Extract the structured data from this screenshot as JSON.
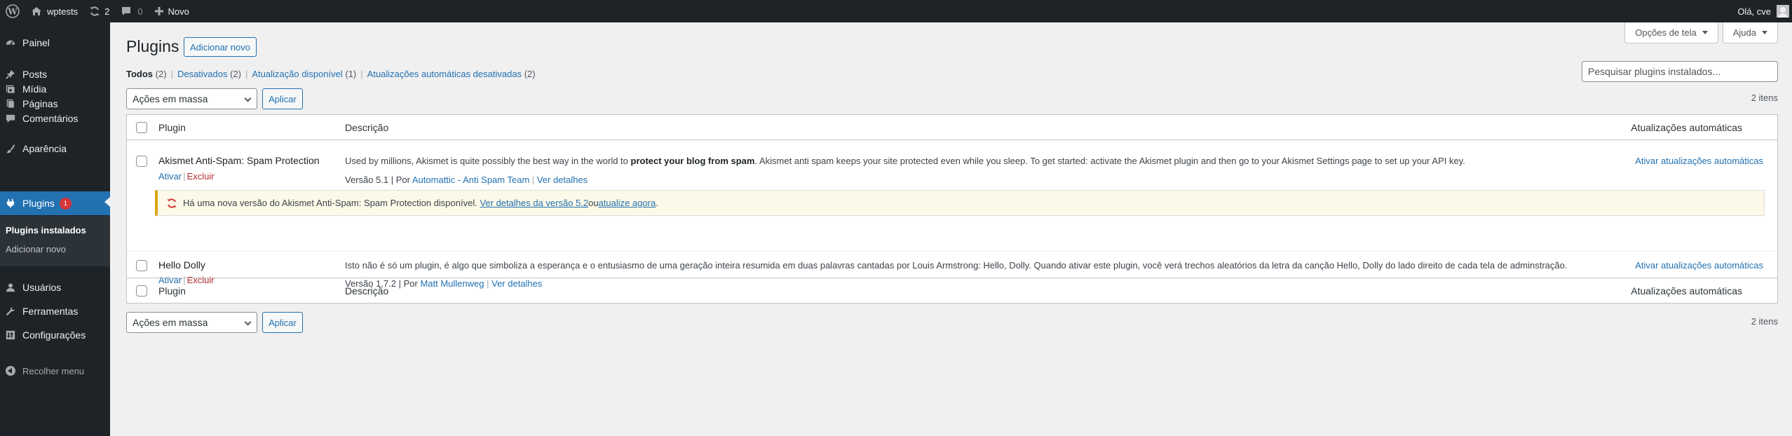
{
  "adminbar": {
    "site_name": "wptests",
    "updates_count": "2",
    "comments_count": "0",
    "new_label": "Novo",
    "greeting": "Olá, cve"
  },
  "sidebar": {
    "items": [
      {
        "label": "Painel",
        "icon": "dashboard-icon"
      },
      {
        "label": "Posts",
        "icon": "pin-icon"
      },
      {
        "label": "Mídia",
        "icon": "media-icon"
      },
      {
        "label": "Páginas",
        "icon": "page-icon"
      },
      {
        "label": "Comentários",
        "icon": "comment-icon"
      },
      {
        "label": "Aparência",
        "icon": "brush-icon"
      },
      {
        "label": "Plugins",
        "icon": "plugin-icon",
        "badge": "1"
      },
      {
        "label": "Usuários",
        "icon": "users-icon"
      },
      {
        "label": "Ferramentas",
        "icon": "wrench-icon"
      },
      {
        "label": "Configurações",
        "icon": "settings-icon"
      }
    ],
    "submenu": [
      "Plugins instalados",
      "Adicionar novo"
    ],
    "collapse_label": "Recolher menu"
  },
  "screen_options": {
    "label": "Opções de tela",
    "help": "Ajuda"
  },
  "page": {
    "title": "Plugins",
    "add_new": "Adicionar novo"
  },
  "views": {
    "all": "Todos",
    "all_count": "(2)",
    "inactive": "Desativados",
    "inactive_count": "(2)",
    "update": "Atualização disponível",
    "update_count": "(1)",
    "autoupdate_off": "Atualizações automáticas desativadas",
    "autoupdate_off_count": "(2)"
  },
  "search": {
    "placeholder": "Pesquisar plugins instalados..."
  },
  "bulk": {
    "label": "Ações em massa",
    "apply": "Aplicar",
    "items_count": "2 itens"
  },
  "table": {
    "columns": {
      "plugin": "Plugin",
      "description": "Descrição",
      "auto_updates": "Atualizações automáticas"
    },
    "rows": [
      {
        "name": "Akismet Anti-Spam: Spam Protection",
        "activate": "Ativar",
        "delete": "Excluir",
        "desc_pre": "Used by millions, Akismet is quite possibly the best way in the world to ",
        "desc_bold": "protect your blog from spam",
        "desc_post": ". Akismet anti spam keeps your site protected even while you sleep. To get started: activate the Akismet plugin and then go to your Akismet Settings page to set up your API key.",
        "version": "Versão 5.1 | Por ",
        "author": "Automattic - Anti Spam Team",
        "details": "Ver detalhes",
        "auto_update": "Ativar atualizações automáticas"
      },
      {
        "name": "Hello Dolly",
        "activate": "Ativar",
        "delete": "Excluir",
        "desc": "Isto não é só um plugin, é algo que simboliza a esperança e o entusiasmo de uma geração inteira resumida em duas palavras cantadas por Louis Armstrong: Hello, Dolly. Quando ativar este plugin, você verá trechos aleatórios da letra da canção Hello, Dolly do lado direito de cada tela de adminstração.",
        "version": "Versão 1.7.2 | Por ",
        "author": "Matt Mullenweg",
        "details": "Ver detalhes",
        "auto_update": "Ativar atualizações automáticas"
      }
    ],
    "notice": {
      "text": "Há uma nova versão do Akismet Anti-Spam: Spam Protection disponível. ",
      "details_link": "Ver detalhes da versão 5.2",
      "or": " ou ",
      "update_link": "atualize agora",
      "end": "."
    }
  },
  "colors": {
    "accent": "#2271b1",
    "sidebar_bg": "#1d2327",
    "delete": "#b32d2e",
    "notice_border": "#dba617",
    "badge": "#d63638"
  }
}
